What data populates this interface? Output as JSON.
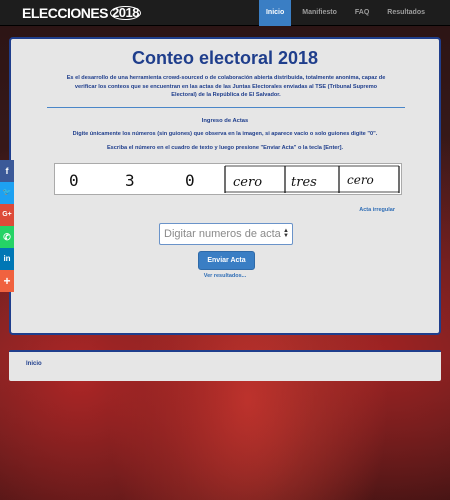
{
  "navbar": {
    "brand_text": "ELECCIONES",
    "brand_year": "2018",
    "items": [
      {
        "label": "Inicio",
        "active": true
      },
      {
        "label": "Manifiesto",
        "active": false
      },
      {
        "label": "FAQ",
        "active": false
      },
      {
        "label": "Resultados",
        "active": false
      }
    ]
  },
  "main": {
    "title": "Conteo electoral 2018",
    "intro": "Es el desarrollo de una herramienta crowd-sourced o de colaboración abierta distribuida, totalmente anonima, capaz de verificar los conteos que se encuentran en las actas de las Juntas Electorales enviadas al TSE (Tribunal Supremo Electoral) de la República de El Salvador.",
    "subtitle": "Ingreso de Actas",
    "instruction_1": "Digite únicamente los números (sin guiones) que observa en la imagen, si aparece vacío o solo guiones digite \"0\".",
    "instruction_2": "Escriba el número en el cuadro de texto y luego presione \"Enviar Acta\" o la tecla [Enter].",
    "captcha_cells": [
      "0",
      "3",
      "0",
      "cero",
      "tres",
      "cero"
    ],
    "irregular_link": "Acta irregular",
    "input_placeholder": "Digitar numeros de acta",
    "submit_label": "Enviar Acta",
    "results_link": "Ver resultados..."
  },
  "footer": {
    "home_link": "Inicio"
  },
  "social": {
    "items": [
      {
        "icon": "facebook-icon",
        "glyph": "f",
        "color": "#3b5998"
      },
      {
        "icon": "twitter-icon",
        "glyph": "🐦",
        "color": "#1da1f2"
      },
      {
        "icon": "google-plus-icon",
        "glyph": "G+",
        "color": "#dd4b39"
      },
      {
        "icon": "whatsapp-icon",
        "glyph": "✆",
        "color": "#25d366"
      },
      {
        "icon": "linkedin-icon",
        "glyph": "in",
        "color": "#0077b5"
      },
      {
        "icon": "share-more-icon",
        "glyph": "+",
        "color": "#f0623f"
      }
    ]
  },
  "colors": {
    "primary": "#1f3e8c",
    "accent": "#3a7ec4",
    "nav_bg": "#1d1d1d",
    "panel_bg": "#e6e6e6"
  }
}
